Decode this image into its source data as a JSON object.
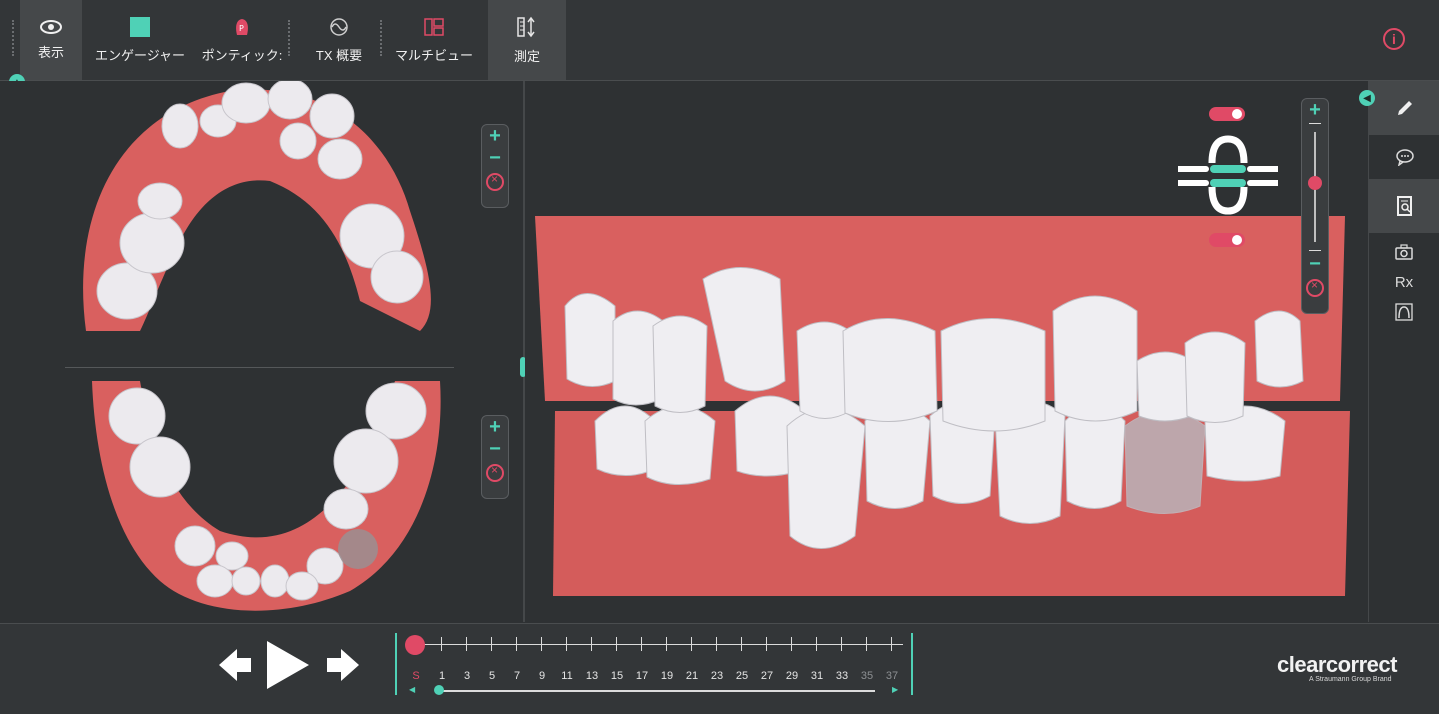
{
  "toolbar": {
    "items": [
      {
        "label": "表示",
        "icon": "eye-icon"
      },
      {
        "label": "エンゲージャー",
        "icon": "engager-square-icon"
      },
      {
        "label": "ポンティック:",
        "icon": "pontic-tooth-icon"
      },
      {
        "label": "TX 概要",
        "icon": "tx-summary-wave-icon"
      },
      {
        "label": "マルチビュー",
        "icon": "multiview-icon"
      },
      {
        "label": "測定",
        "icon": "measure-icon"
      }
    ],
    "info_icon": "info-icon",
    "active_item": "測定"
  },
  "colors": {
    "accent_teal": "#4fd1b6",
    "accent_pink": "#e04a66",
    "gum": "#d9605f",
    "tooth": "#eeeef0",
    "background": "#2e3133"
  },
  "right_rail": {
    "icons": [
      "pencil-icon",
      "comment-icon",
      "document-search-icon",
      "camera-icon",
      "rx-icon",
      "arch-scan-icon"
    ],
    "rx_label": "Rx"
  },
  "zoom": {
    "plus": "+",
    "minus": "−"
  },
  "timeline": {
    "start_label": "S",
    "stage_labels": [
      "1",
      "3",
      "5",
      "7",
      "9",
      "11",
      "13",
      "15",
      "17",
      "19",
      "21",
      "23",
      "25",
      "27",
      "29",
      "31",
      "33",
      "35",
      "37"
    ],
    "dimmed_labels": [
      "35",
      "37"
    ],
    "current_stage": "S"
  },
  "playback": {
    "prev": "prev-stage",
    "play": "play",
    "next": "next-stage"
  },
  "brand": {
    "name": "clearcorrect",
    "tagline": "A Straumann Group Brand"
  }
}
